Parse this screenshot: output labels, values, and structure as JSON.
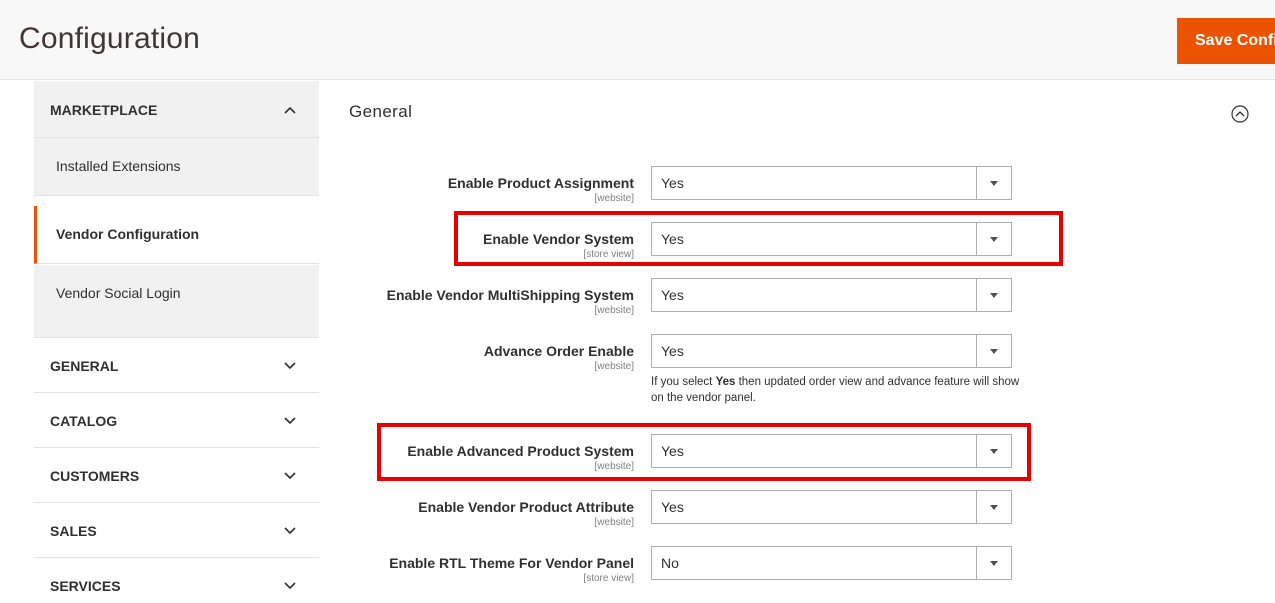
{
  "header": {
    "title": "Configuration",
    "save_label": "Save Config"
  },
  "sidebar": {
    "marketplace": {
      "label": "MARKETPLACE",
      "items": [
        {
          "label": "Installed Extensions",
          "active": false
        },
        {
          "label": "Vendor Configuration",
          "active": true
        },
        {
          "label": "Vendor Social Login",
          "active": false
        }
      ]
    },
    "categories": [
      {
        "label": "GENERAL"
      },
      {
        "label": "CATALOG"
      },
      {
        "label": "CUSTOMERS"
      },
      {
        "label": "SALES"
      },
      {
        "label": "SERVICES"
      }
    ]
  },
  "main": {
    "section_title": "General",
    "fields": [
      {
        "label": "Enable Product Assignment",
        "scope": "[website]",
        "value": "Yes"
      },
      {
        "label": "Enable Vendor System",
        "scope": "[store view]",
        "value": "Yes"
      },
      {
        "label": "Enable Vendor MultiShipping System",
        "scope": "[website]",
        "value": "Yes"
      },
      {
        "label": "Advance Order Enable",
        "scope": "[website]",
        "value": "Yes",
        "note_prefix": "If you select ",
        "note_bold": "Yes",
        "note_suffix": " then updated order view and advance feature will show on the vendor panel."
      },
      {
        "label": "Enable Advanced Product System",
        "scope": "[website]",
        "value": "Yes"
      },
      {
        "label": "Enable Vendor Product Attribute",
        "scope": "[website]",
        "value": "Yes"
      },
      {
        "label": "Enable RTL Theme For Vendor Panel",
        "scope": "[store view]",
        "value": "No"
      }
    ]
  },
  "colors": {
    "accent": "#eb5202",
    "highlight": "#e60000"
  },
  "icons": {
    "collapse": "chevron-up-icon",
    "expand": "chevron-down-icon",
    "section_toggle": "circle-chevron-up-icon"
  }
}
